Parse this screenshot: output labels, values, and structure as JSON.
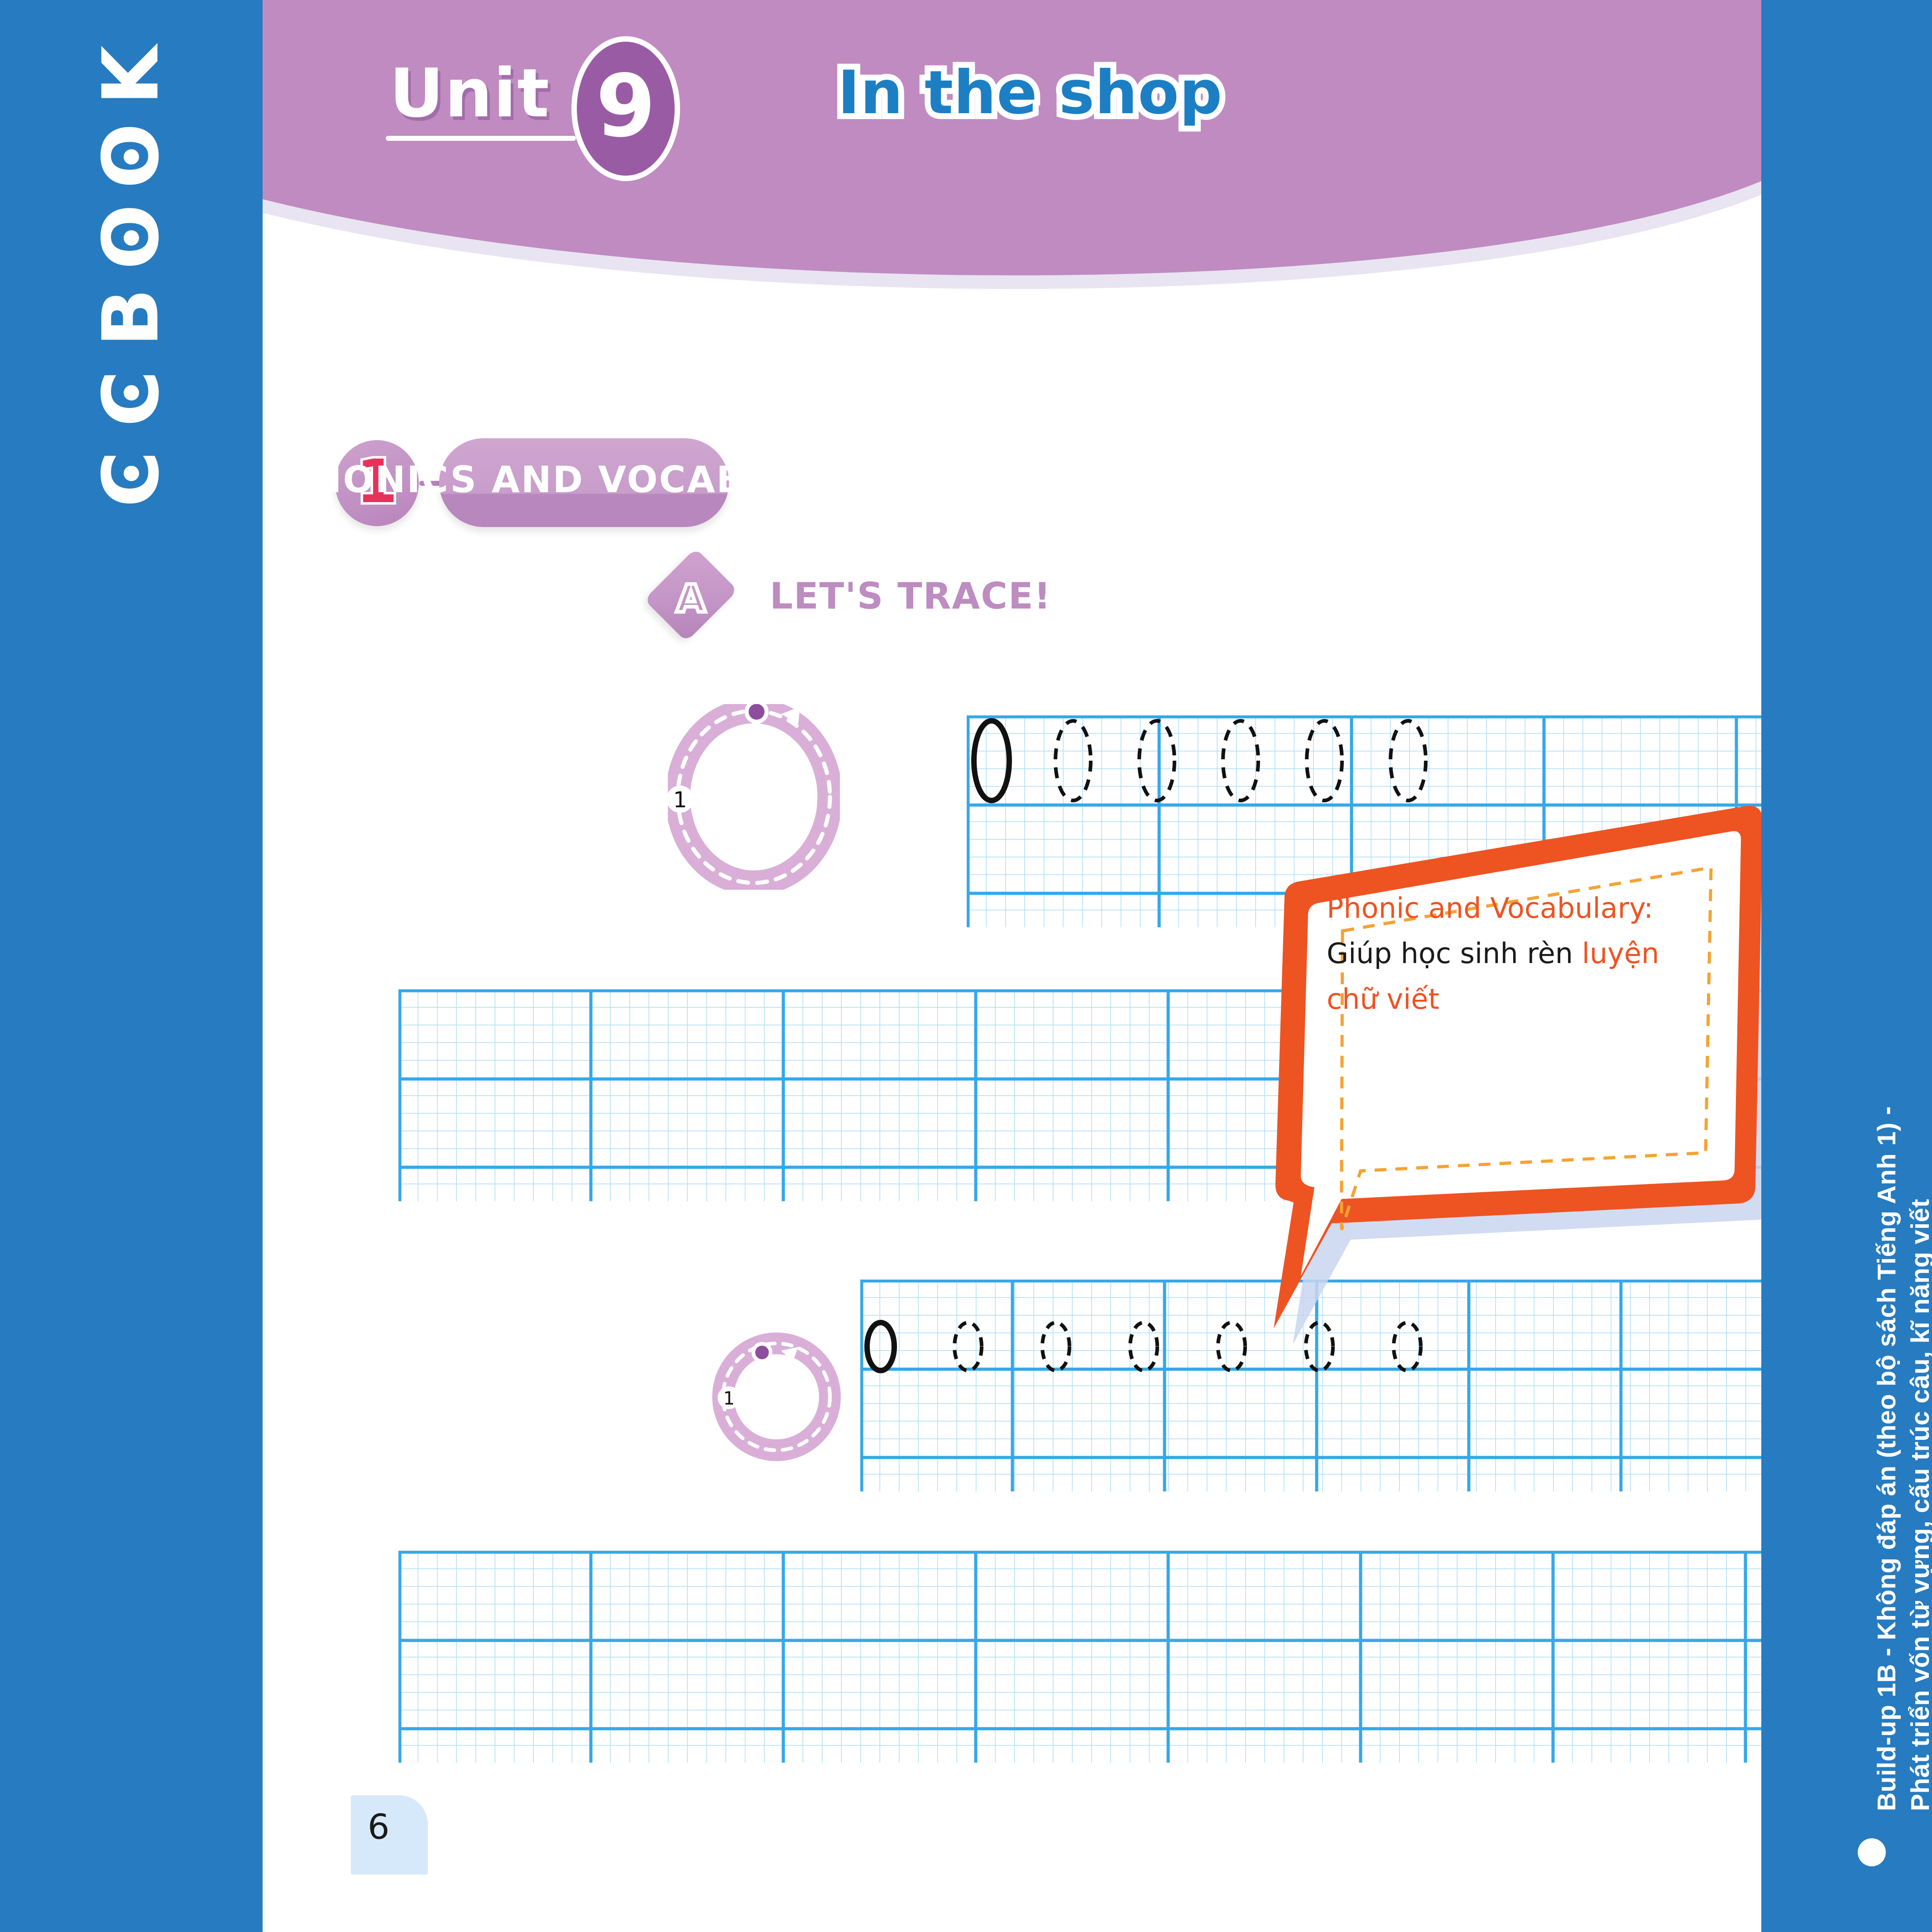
{
  "brand": {
    "logo_letters": [
      "C",
      "C",
      "B",
      "O",
      "O",
      "K"
    ],
    "logo_name": "CCBOOK"
  },
  "header": {
    "unit_label": "Unit",
    "unit_number": "9",
    "title": "In the shop",
    "bg_color": "#C08BC1",
    "badge_color": "#9A5BA5",
    "title_color": "#1C7FC4"
  },
  "section": {
    "number": "1",
    "number_color": "#E8325B",
    "title": "PHONICS AND VOCABULARY",
    "pill_color": "#C89DCA"
  },
  "subsection": {
    "letter": "A",
    "title": "LET'S TRACE!",
    "label_color": "#BD8CC0"
  },
  "tracing": {
    "stroke_number": "1",
    "rows": [
      {
        "name": "uppercase-o-row",
        "letter": "O",
        "case": "uppercase",
        "solid_count": 1,
        "dashed_count": 5,
        "total": 6
      },
      {
        "name": "blank-practice-row-1",
        "letter": "",
        "case": "blank",
        "solid_count": 0,
        "dashed_count": 0,
        "total": 0
      },
      {
        "name": "lowercase-o-row",
        "letter": "o",
        "case": "lowercase",
        "solid_count": 1,
        "dashed_count": 6,
        "total": 7
      },
      {
        "name": "blank-practice-row-2",
        "letter": "",
        "case": "blank",
        "solid_count": 0,
        "dashed_count": 0,
        "total": 0
      }
    ],
    "grid_color": "#35A8E8",
    "grid_minor_color": "#AEDDF6",
    "guide_ring_color": "#D9AFD8",
    "guide_dot_color": "#8E4E9E"
  },
  "callout": {
    "line1": "Phonic and Vocabulary:",
    "line2_plain": "Giúp học sinh rèn ",
    "line2_accent": "luyện",
    "line3_accent": "chữ viết",
    "border_color": "#EE5322",
    "accent_color": "#EE5322",
    "inner_dash_color": "#F5A233"
  },
  "footer": {
    "page_number": "6"
  },
  "right_rail": {
    "line_1": "Build-up 1B - Không đáp án (theo bộ sách Tiếng Anh 1) -",
    "line_2": "Phát triển vốn từ vựng, cấu trúc câu, kĩ năng viết",
    "bullet": "•",
    "bg_color": "#277BC0"
  }
}
